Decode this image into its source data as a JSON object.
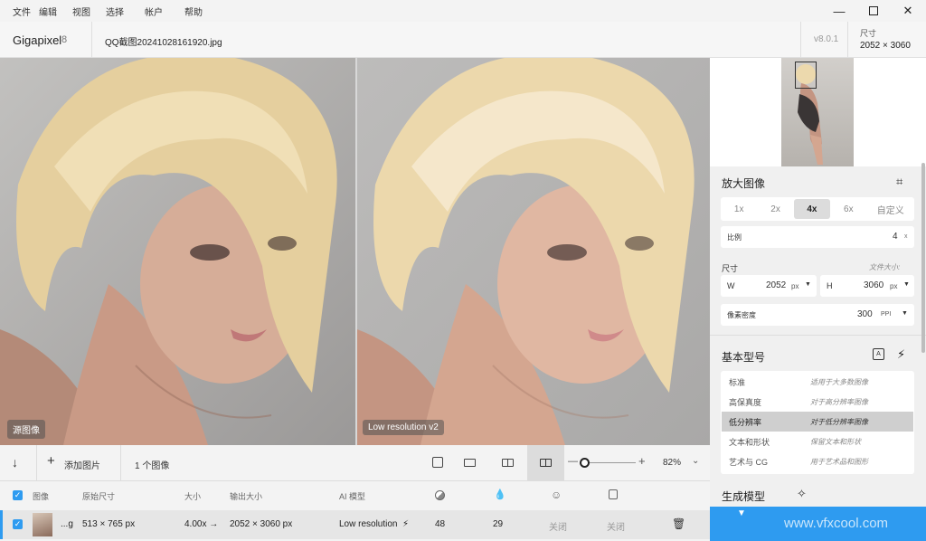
{
  "menu": [
    "文件",
    "编辑",
    "视图",
    "选择",
    "帐户",
    "帮助"
  ],
  "app": {
    "name": "Gigapixel",
    "version_badge": "8",
    "filename": "QQ截图20241028161920.jpg",
    "version": "v8.0.1",
    "size_label": "尺寸",
    "size_value": "2052 × 3060"
  },
  "canvas": {
    "left_tag": "源图像",
    "right_tag": "Low resolution v2"
  },
  "toolbar": {
    "add_label": "添加图片",
    "count_label": "1 个图像",
    "zoom": "82%"
  },
  "list": {
    "headers": {
      "image": "图像",
      "orig": "原始尺寸",
      "scale": "大小",
      "output": "输出大小",
      "model": "AI 模型"
    },
    "row": {
      "name": "...g",
      "orig": "513 × 765 px",
      "scale": "4.00x →",
      "output": "2052 × 3060 px",
      "model": "Low resolution",
      "v1": "48",
      "v2": "29",
      "v3": "关闭",
      "v4": "关闭"
    }
  },
  "panel": {
    "upscale_title": "放大图像",
    "scales": [
      "1x",
      "2x",
      "4x",
      "6x",
      "自定义"
    ],
    "active_scale": "4x",
    "ratio_label": "比例",
    "ratio_value": "4",
    "ratio_unit": "x",
    "dim_label": "尺寸",
    "file_size_label": "文件大小:",
    "w_label": "W",
    "w_value": "2052",
    "w_unit": "px",
    "h_label": "H",
    "h_value": "3060",
    "h_unit": "px",
    "ppi_label": "像素密度",
    "ppi_value": "300",
    "ppi_unit": "PPI",
    "model_title": "基本型号",
    "models": [
      {
        "name": "标准",
        "desc": "适用于大多数图像"
      },
      {
        "name": "高保真度",
        "desc": "对于高分辨率图像"
      },
      {
        "name": "低分辨率",
        "desc": "对于低分辨率图像"
      },
      {
        "name": "文本和形状",
        "desc": "保留文本和形状"
      },
      {
        "name": "艺术与 CG",
        "desc": "用于艺术品和图形"
      }
    ],
    "active_model": "低分辨率",
    "gen_label": "生成模型"
  },
  "watermark": "www.vfxcool.com",
  "colors": {
    "accent": "#2e9bf0",
    "selected_model": "#cfcfcf"
  }
}
